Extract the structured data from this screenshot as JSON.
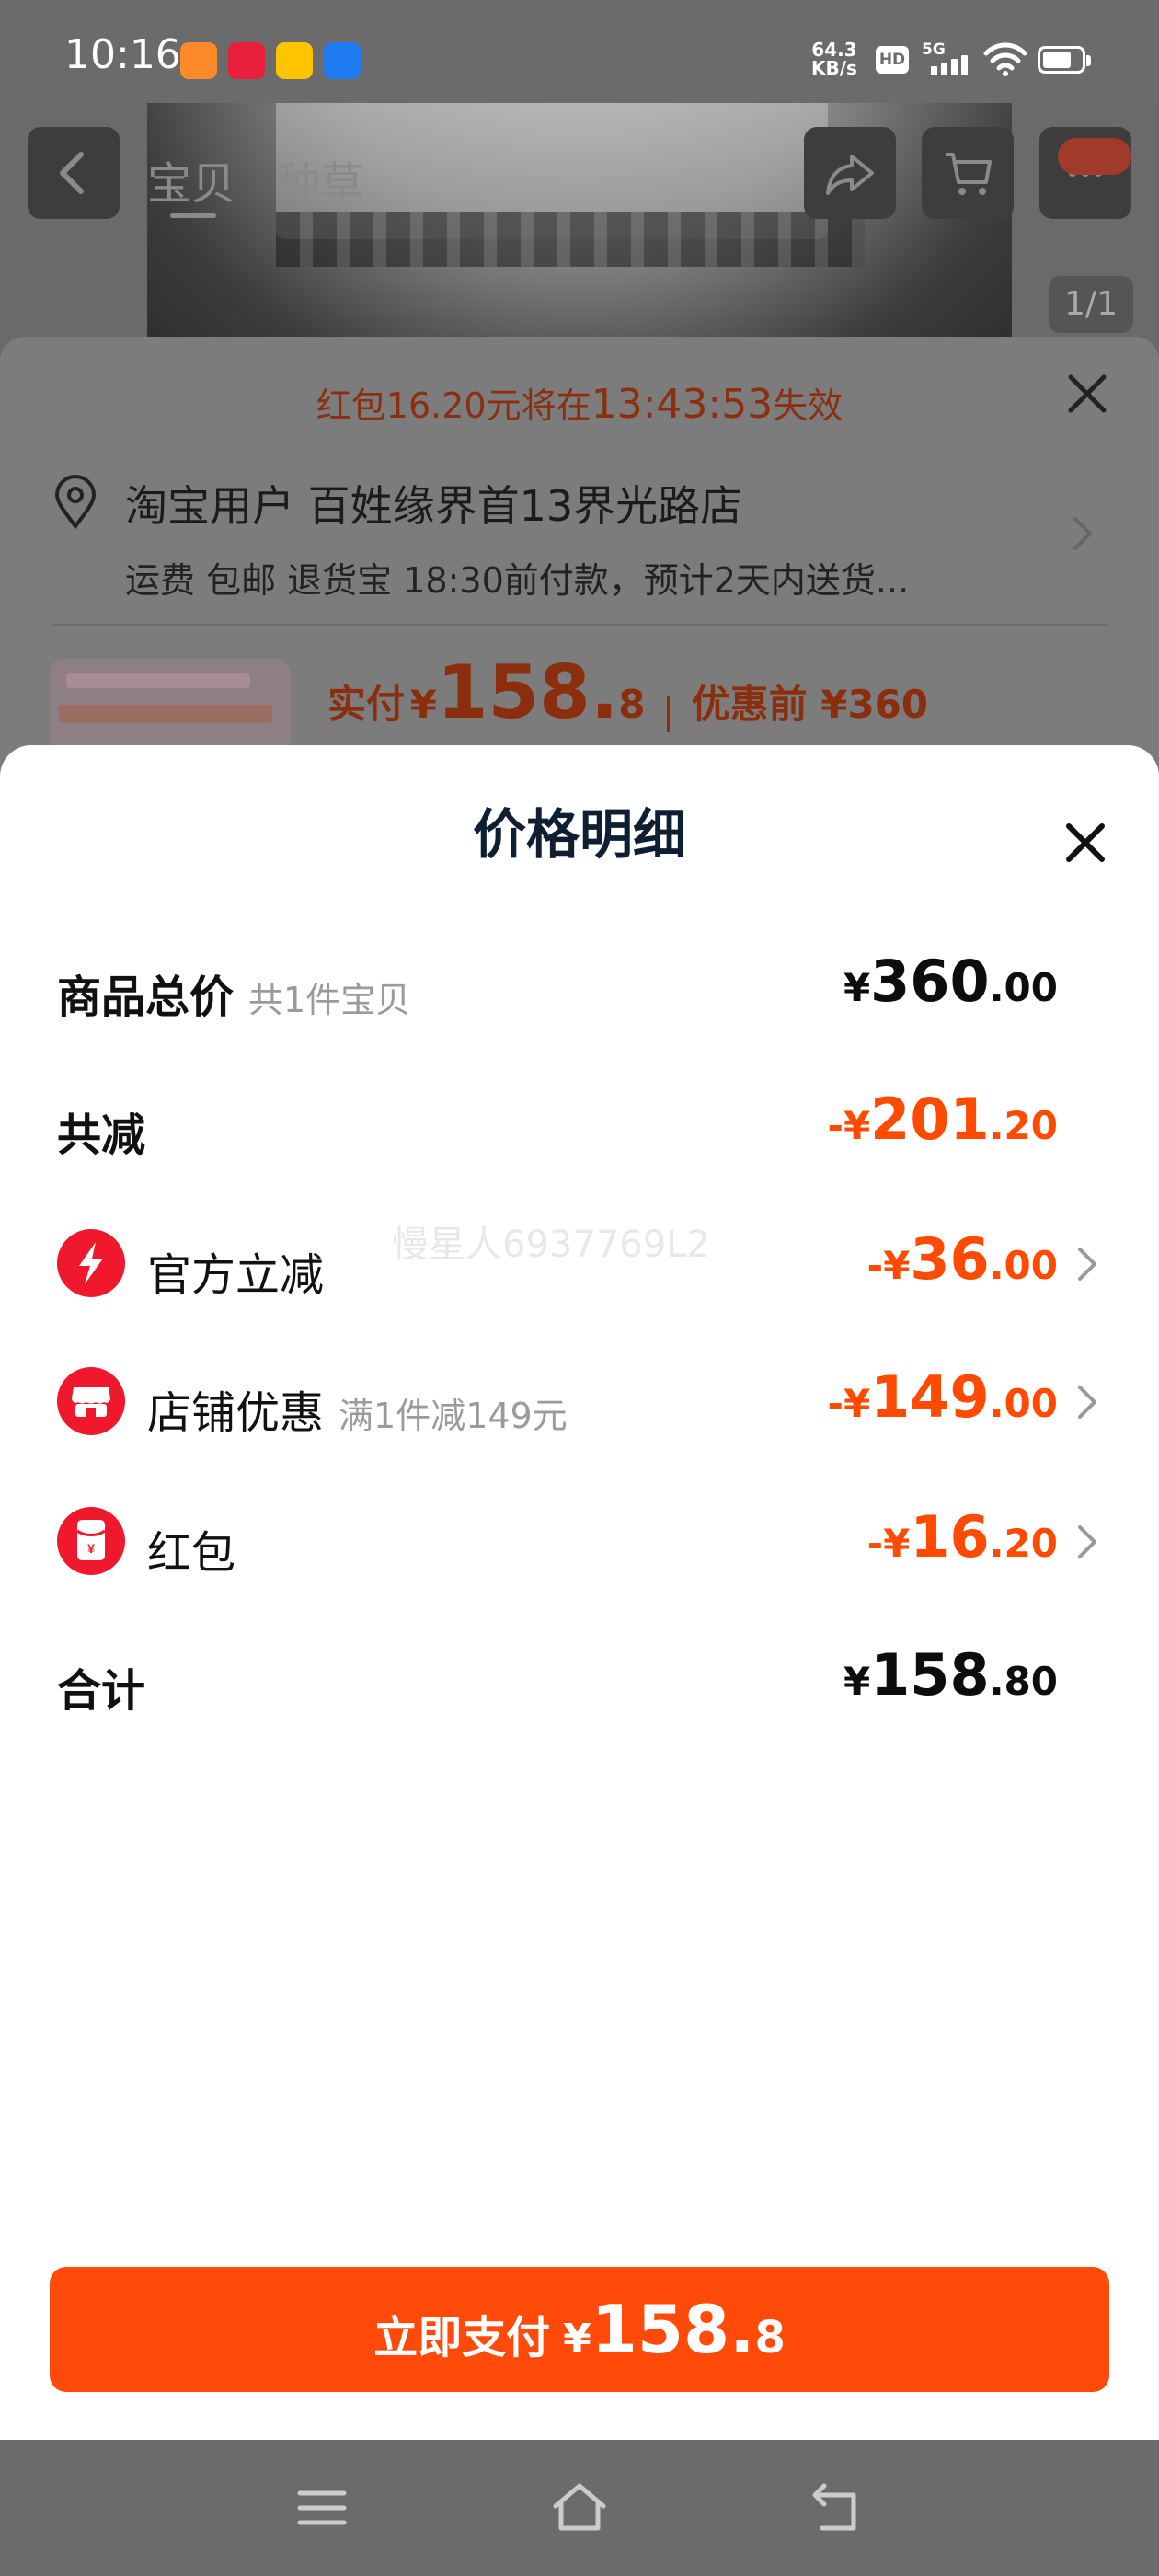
{
  "status_bar": {
    "time": "10:16",
    "net_speed_value": "64.3",
    "net_speed_unit": "KB/s",
    "hd_badge": "HD",
    "network": "5G",
    "app_icons": [
      "video-app-icon",
      "xiaohongshu-icon",
      "meituan-icon",
      "feishu-icon"
    ],
    "app_icon_colors": [
      "#ff8a2a",
      "#e8203c",
      "#ffc400",
      "#1e7cf0"
    ]
  },
  "top_nav": {
    "tabs": [
      "宝贝",
      "种草"
    ],
    "image_counter": "1/1",
    "icons": [
      "back-icon",
      "share-icon",
      "cart-icon",
      "more-icon"
    ]
  },
  "checkout_sheet": {
    "countdown_prefix": "红包16.20元将在",
    "countdown_time": "13:43:53",
    "countdown_suffix": "失效",
    "store_name": "淘宝用户 百姓缘界首13界光路店",
    "delivery_info": "运费 包邮 退货宝 18:30前付款，预计2天内送货...",
    "pay_label": "实付",
    "pay_currency": "¥",
    "pay_int": "158.",
    "pay_dec": "8",
    "before_discount": "优惠前 ¥360"
  },
  "price_detail": {
    "title": "价格明细",
    "rows": [
      {
        "label": "商品总价",
        "sub": "共1件宝贝",
        "currency": "¥",
        "int": "360",
        "dec": ".00",
        "has_icon": false,
        "has_chevron": false
      },
      {
        "label": "共减",
        "sub": "",
        "currency": "-¥",
        "int": "201",
        "dec": ".20",
        "has_icon": false,
        "has_chevron": false
      },
      {
        "label": "官方立减",
        "sub": "",
        "currency": "-¥",
        "int": "36",
        "dec": ".00",
        "icon": "lightning-icon",
        "has_chevron": true
      },
      {
        "label": "店铺优惠",
        "sub": "满1件减149元",
        "currency": "-¥",
        "int": "149",
        "dec": ".00",
        "icon": "store-icon",
        "has_chevron": true
      },
      {
        "label": "红包",
        "sub": "",
        "currency": "-¥",
        "int": "16",
        "dec": ".20",
        "icon": "red-envelope-icon",
        "has_chevron": true
      },
      {
        "label": "合计",
        "sub": "",
        "currency": "¥",
        "int": "158",
        "dec": ".80",
        "has_icon": false,
        "has_chevron": false
      }
    ],
    "watermark": "慢星人6937769L2"
  },
  "pay_button": {
    "label": "立即支付",
    "currency": "¥",
    "int": "158.",
    "dec": "8"
  },
  "system_nav": {
    "icons": [
      "menu-icon",
      "home-icon",
      "return-icon"
    ]
  },
  "colors": {
    "accent": "#ff4a0a",
    "discount_red": "#ff4a00",
    "title_navy": "#0f1f33",
    "icon_red": "#f0182c"
  }
}
